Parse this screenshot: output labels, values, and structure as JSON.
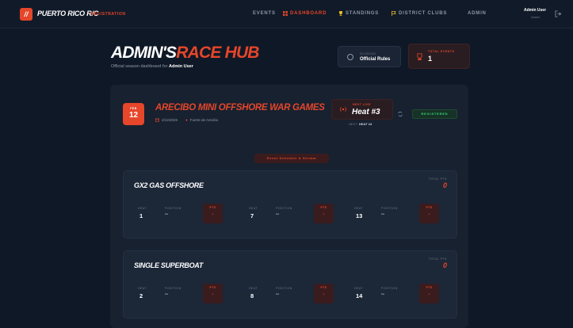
{
  "nav": {
    "logo_glyph": "//",
    "brand": "PUERTO RICO R/C",
    "brand_sub": "REGISTRATION",
    "links": [
      {
        "label": "EVENTS",
        "icon": "none"
      },
      {
        "label": "DASHBOARD",
        "icon": "dashboard-icon"
      },
      {
        "label": "STANDINGS",
        "icon": "trophy-icon"
      },
      {
        "label": "DISTRICT CLUBS",
        "icon": "flag-icon"
      },
      {
        "label": "ADMIN",
        "icon": "none"
      }
    ],
    "user_name": "Admin User",
    "user_role": "Admin"
  },
  "hero": {
    "title_main": "ADMIN'S",
    "title_accent": "RACE HUB",
    "subtitle_prefix": "Official season dashboard for ",
    "subtitle_user": "Admin User",
    "rules_label": "SCORING",
    "rules_value": "Official Rules",
    "events_label": "TOTAL EVENTS",
    "events_value": "1"
  },
  "event": {
    "month": "FEB",
    "day": "12",
    "title": "ARECIBO MINI OFFSHORE WAR GAMES",
    "date": "2/12/2026",
    "location": "Fuerte de Arecibo",
    "live_label": "NEXT LIVE",
    "live_value": "Heat #3",
    "next_label": "NEXT",
    "next_value": "HEAT #4",
    "status": "REGISTERED",
    "schedule_btn": "Event Schedule & Stream"
  },
  "labels": {
    "total_pts": "TOTAL PTS",
    "heat": "HEAT",
    "position": "POSITION",
    "pts": "PTS"
  },
  "classes": [
    {
      "name": "GX2 GAS OFFSHORE",
      "total": "0",
      "heats": [
        {
          "heat": "1",
          "position": "--",
          "pts": "-"
        },
        {
          "heat": "7",
          "position": "--",
          "pts": "-"
        },
        {
          "heat": "13",
          "position": "--",
          "pts": "-"
        }
      ]
    },
    {
      "name": "SINGLE SUPERBOAT",
      "total": "0",
      "heats": [
        {
          "heat": "2",
          "position": "--",
          "pts": "-"
        },
        {
          "heat": "8",
          "position": "--",
          "pts": "-"
        },
        {
          "heat": "14",
          "position": "--",
          "pts": "-"
        }
      ]
    }
  ],
  "colors": {
    "accent": "#e6462a",
    "background": "#0f1826",
    "success": "#2fdc7e"
  }
}
